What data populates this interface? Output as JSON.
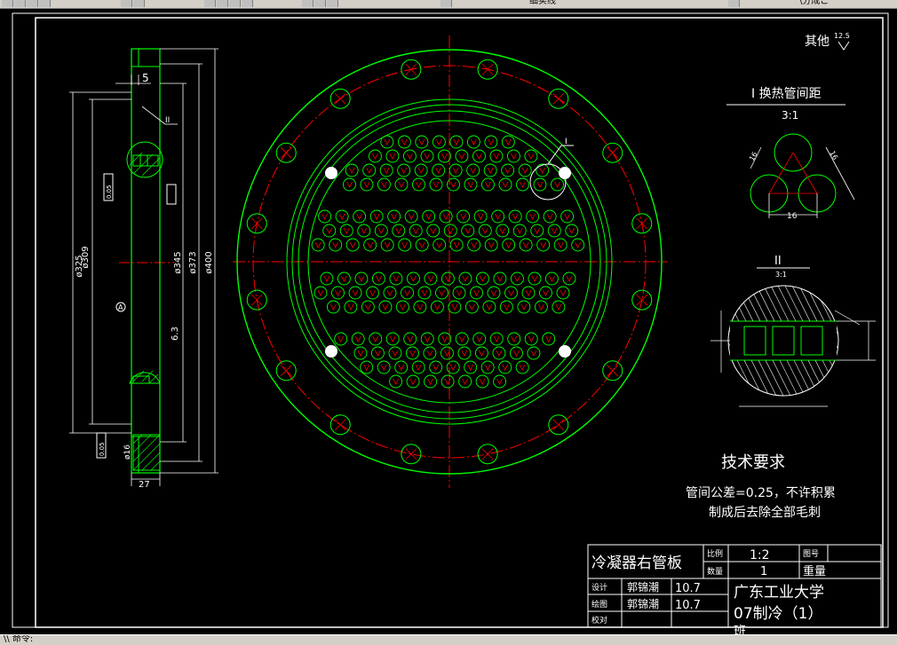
{
  "toolbar": {
    "layer_name": "细实线",
    "extra": "\\分成ご"
  },
  "statusbar": {
    "text": "\\\\ 命令: "
  },
  "colors": {
    "green": "#00ff00",
    "red": "#ff0000",
    "white": "#ffffff",
    "cyan": "#00ffff",
    "frame": "#ffffff"
  },
  "drawing": {
    "roughness_note": "其他",
    "roughness_value": "12.5",
    "detail1_title": "I 换热管间距",
    "detail1_scale": "3:1",
    "detail1_dim": "16",
    "detail1_pitch_a": "16",
    "detail1_pitch_b": "16",
    "detail2_title": "II",
    "detail2_scale": "3:1",
    "marker_I": "I",
    "marker_II": "II",
    "side_dims": {
      "d325": "ø325",
      "d309": "ø309",
      "d345": "ø345",
      "d373": "ø373",
      "d400": "ø400",
      "w5": "5",
      "w27": "27",
      "d16": "ø16",
      "r63": "6.3",
      "datum": "A",
      "tol1": "0.05",
      "tol2": "0.05"
    },
    "tech_title": "技术要求",
    "tech_line1": "管间公差=0.25，不许积累",
    "tech_line2": "制成后去除全部毛刺"
  },
  "title_block": {
    "name": "冷凝器右管板",
    "scale_label": "比例",
    "scale_value": "1:2",
    "drawing_no_label": "图号",
    "qty_label": "数量",
    "qty_value": "1",
    "weight_label": "重量",
    "designer_label": "设计",
    "designer_name": "郭锦潮",
    "designer_date": "10.7",
    "checker_label": "绘图",
    "checker_name": "郭锦潮",
    "checker_date": "10.7",
    "reviewer_label": "校对",
    "school": "广东工业大学",
    "class_name": "07制冷（1）",
    "class_suffix": "班"
  }
}
